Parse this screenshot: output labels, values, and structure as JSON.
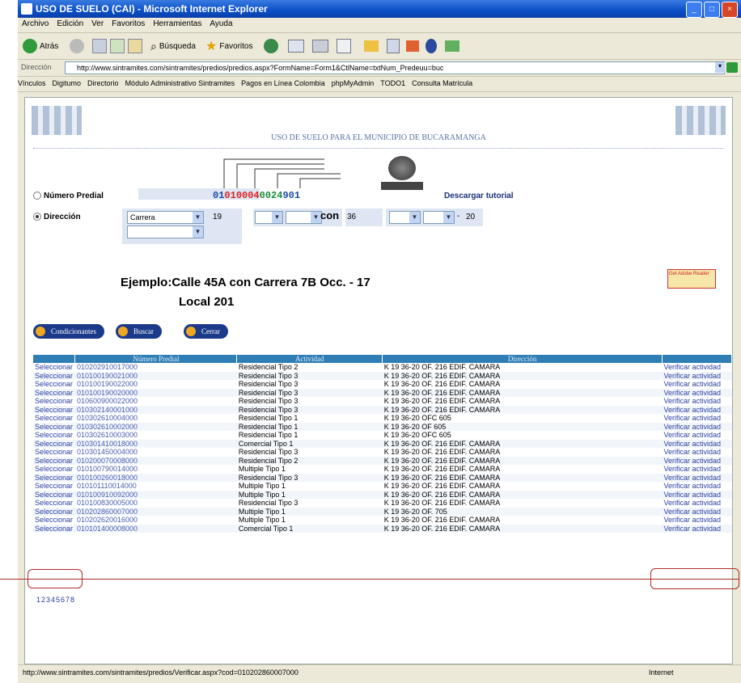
{
  "window": {
    "title": "USO DE SUELO (CAI) - Microsoft Internet Explorer"
  },
  "menu": [
    "Archivo",
    "Edición",
    "Ver",
    "Favoritos",
    "Herramientas",
    "Ayuda"
  ],
  "toolbar": {
    "back": "Atrás",
    "search": "Búsqueda",
    "favorites": "Favoritos"
  },
  "address": {
    "label": "Dirección",
    "url": "http://www.sintramites.com/sintramites/predios/predios.aspx?FormName=Form1&CtlName=txtNum_Predeuu=buc"
  },
  "links": {
    "label": "Vínculos",
    "items": [
      "Digitumo",
      "Directorio",
      "Módulo Administrativo Sintramites",
      "Pagos en Línea Colombia",
      "phpMyAdmin",
      "TODO1",
      "Consulta Matrícula"
    ]
  },
  "page": {
    "title": "USO DE SUELO PARA EL MUNICIPIO DE BUCARAMANGA",
    "radio_predial": "Número Predial",
    "radio_direccion": "Dirección",
    "code_parts": [
      "01",
      "01",
      "0004",
      "0024",
      "901"
    ],
    "download_tutorial": "Descargar tutorial",
    "via_type": "Carrera",
    "num1": "19",
    "con": "con",
    "num2": "36",
    "num3": "20",
    "dash": "-",
    "example_line1": "Ejemplo:Calle 45A con Carrera 7B Occ. - 17",
    "example_line2": "Local 201",
    "adobe_text": "Get Adobe Reader",
    "buttons": {
      "conditions": "Condicionantes",
      "search": "Buscar",
      "close": "Cerrar"
    }
  },
  "table": {
    "headers": [
      "",
      "Número Predial",
      "Actividad",
      "Dirección",
      ""
    ],
    "rows": [
      [
        "Seleccionar",
        "010202910017000",
        "Residencial Tipo 2",
        "K 19 36-20 OF. 216 EDIF. CAMARA",
        "Verificar actividad"
      ],
      [
        "Seleccionar",
        "010100190021000",
        "Residencial Tipo 3",
        "K 19 36-20 OF. 216 EDIF. CAMARA",
        "Verificar actividad"
      ],
      [
        "Seleccionar",
        "010100190022000",
        "Residencial Tipo 3",
        "K 19 36-20 OF. 216 EDIF. CAMARA",
        "Verificar actividad"
      ],
      [
        "Seleccionar",
        "010100190020000",
        "Residencial Tipo 3",
        "K 19 36-20 OF. 216 EDIF. CAMARA",
        "Verificar actividad"
      ],
      [
        "Seleccionar",
        "010600900022000",
        "Residencial Tipo 3",
        "K 19 36-20 OF. 216 EDIF. CAMARA",
        "Verificar actividad"
      ],
      [
        "Seleccionar",
        "010302140001000",
        "Residencial Tipo 3",
        "K 19 36-20 OF. 216 EDIF. CAMARA",
        "Verificar actividad"
      ],
      [
        "Seleccionar",
        "010302610004000",
        "Residencial Tipo 1",
        "K 19 36-20 OFC 605",
        "Verificar actividad"
      ],
      [
        "Seleccionar",
        "010302610002000",
        "Residencial Tipo 1",
        "K 19 36-20 OF 605",
        "Verificar actividad"
      ],
      [
        "Seleccionar",
        "010302610003000",
        "Residencial Tipo 1",
        "K 19 36-20 OFC 605",
        "Verificar actividad"
      ],
      [
        "Seleccionar",
        "010301410018000",
        "Comercial Tipo 1",
        "K 19 36-20 OF. 216 EDIF. CAMARA",
        "Verificar actividad"
      ],
      [
        "Seleccionar",
        "010301450004000",
        "Residencial Tipo 3",
        "K 19 36-20 OF. 216 EDIF. CAMARA",
        "Verificar actividad"
      ],
      [
        "Seleccionar",
        "010200070008000",
        "Residencial Tipo 2",
        "K 19 36-20 OF. 216 EDIF. CAMARA",
        "Verificar actividad"
      ],
      [
        "Seleccionar",
        "010100790014000",
        "Multiple Tipo 1",
        "K 19 36-20 OF. 216 EDIF. CAMARA",
        "Verificar actividad"
      ],
      [
        "Seleccionar",
        "010100260018000",
        "Residencial Tipo 3",
        "K 19 36-20 OF. 216 EDIF. CAMARA",
        "Verificar actividad"
      ],
      [
        "Seleccionar",
        "010101110014000",
        "Multiple Tipo 1",
        "K 19 36-20 OF. 216 EDIF. CAMARA",
        "Verificar actividad"
      ],
      [
        "Seleccionar",
        "010100910092000",
        "Multiple Tipo 1",
        "K 19 36-20 OF. 216 EDIF. CAMARA",
        "Verificar actividad"
      ],
      [
        "Seleccionar",
        "010100830005000",
        "Residencial Tipo 3",
        "K 19 36-20 OF. 216 EDIF. CAMARA",
        "Verificar actividad"
      ],
      [
        "Seleccionar",
        "010202860007000",
        "Multiple Tipo 1",
        "K 19 36-20 OF. 705",
        "Verificar actividad"
      ],
      [
        "Seleccionar",
        "010202620016000",
        "Multiple Tipo 1",
        "K 19 36-20 OF. 216 EDIF. CAMARA",
        "Verificar actividad"
      ],
      [
        "Seleccionar",
        "010101400008000",
        "Comercial Tipo 1",
        "K 19 36-20 OF. 216 EDIF. CAMARA",
        "Verificar actividad"
      ]
    ]
  },
  "pager": "12345678",
  "status": {
    "url": "http://www.sintramites.com/sintramites/predios/Verificar.aspx?cod=010202860007000",
    "zone": "Internet"
  }
}
